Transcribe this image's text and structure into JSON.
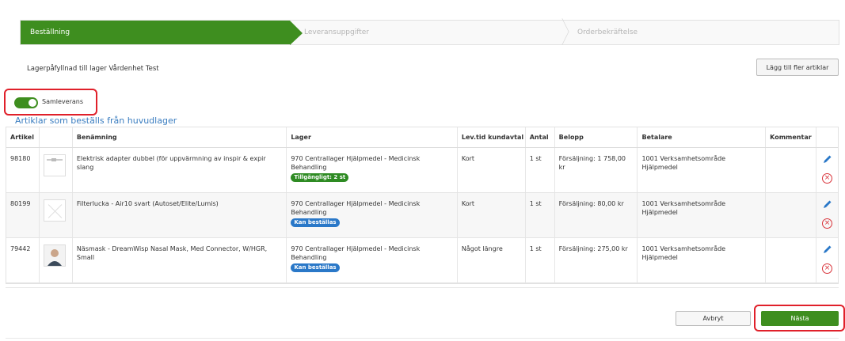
{
  "steps": {
    "step1": "Beställning",
    "step2": "Leveransuppgifter",
    "step3": "Orderbekräftelse"
  },
  "subtitle": "Lagerpåfyllnad till lager Vårdenhet Test",
  "add_button": "Lägg till fler artiklar",
  "toggle": {
    "label": "Samleverans",
    "on": true
  },
  "section_title": "Artiklar som beställs från huvudlager",
  "table": {
    "headers": [
      "Artikel",
      "",
      "Benämning",
      "Lager",
      "Lev.tid kundavtal",
      "Antal",
      "Belopp",
      "Betalare",
      "Kommentar",
      ""
    ],
    "rows": [
      {
        "artikel": "98180",
        "benamning": "Elektrisk adapter dubbel (för uppvärmning av inspir & expir slang",
        "lager": "970 Centrallager Hjälpmedel - Medicinsk Behandling",
        "badge": "Tillgängligt: 2 st",
        "badge_color": "#2e8b23",
        "levtid": "Kort",
        "antal": "1 st",
        "belopp": "Försäljning: 1 758,00 kr",
        "betalare": "1001 Verksamhetsområde Hjälpmedel",
        "kommentar": ""
      },
      {
        "artikel": "80199",
        "benamning": "Filterlucka - Air10 svart (Autoset/Elite/Lumis)",
        "lager": "970 Centrallager Hjälpmedel - Medicinsk Behandling",
        "badge": "Kan beställas",
        "badge_color": "#2a78c8",
        "levtid": "Kort",
        "antal": "1 st",
        "belopp": "Försäljning: 80,00 kr",
        "betalare": "1001 Verksamhetsområde Hjälpmedel",
        "kommentar": ""
      },
      {
        "artikel": "79442",
        "benamning": "Näsmask - DreamWisp Nasal Mask, Med Connector, W/HGR, Small",
        "lager": "970 Centrallager Hjälpmedel - Medicinsk Behandling",
        "badge": "Kan beställas",
        "badge_color": "#2a78c8",
        "levtid": "Något längre",
        "antal": "1 st",
        "belopp": "Försäljning: 275,00 kr",
        "betalare": "1001 Verksamhetsområde Hjälpmedel",
        "kommentar": ""
      }
    ]
  },
  "buttons": {
    "cancel": "Avbryt",
    "next": "Nästa"
  },
  "colors": {
    "accent_green": "#3e8e1f",
    "link_blue": "#3a7dc0",
    "highlight_red": "#e0202a"
  }
}
